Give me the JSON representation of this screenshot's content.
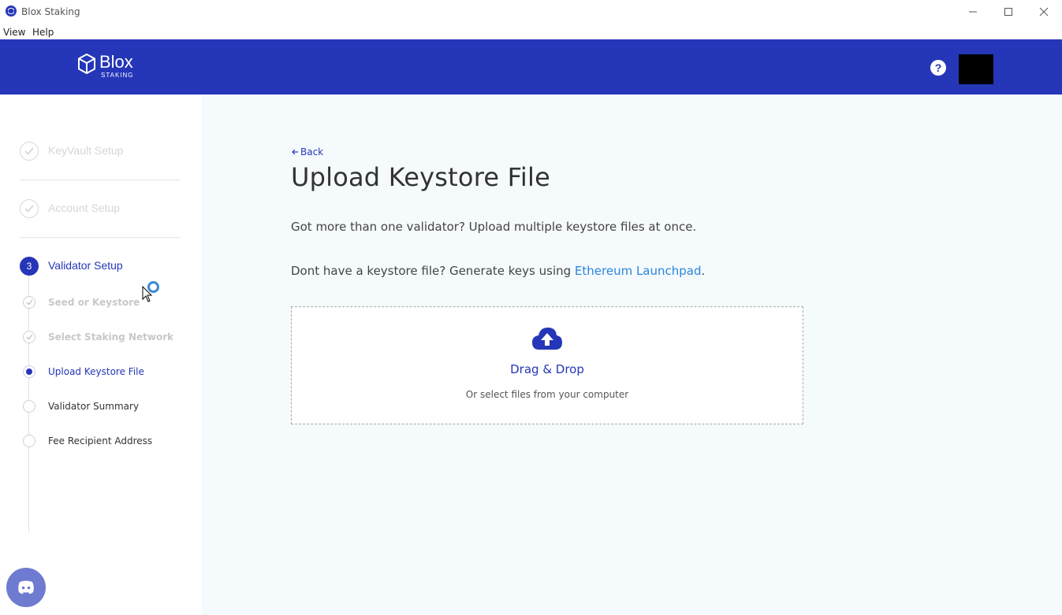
{
  "window": {
    "title": "Blox Staking"
  },
  "menu": {
    "items": [
      "View",
      "Help"
    ]
  },
  "header": {
    "logo_name": "Blox",
    "logo_sub": "STAKING",
    "help_label": "?"
  },
  "sidebar": {
    "steps": [
      {
        "number": "",
        "label": "KeyVault Setup",
        "state": "done"
      },
      {
        "number": "",
        "label": "Account Setup",
        "state": "done"
      },
      {
        "number": "3",
        "label": "Validator Setup",
        "state": "active"
      }
    ],
    "substeps": [
      {
        "label": "Seed or Keystore",
        "state": "done"
      },
      {
        "label": "Select Staking Network",
        "state": "done"
      },
      {
        "label": "Upload Keystore File",
        "state": "current"
      },
      {
        "label": "Validator Summary",
        "state": "todo"
      },
      {
        "label": "Fee Recipient Address",
        "state": "todo"
      }
    ]
  },
  "main": {
    "back_label": "Back",
    "title": "Upload Keystore File",
    "para1": "Got more than one validator? Upload multiple keystore files at once.",
    "para2_prefix": "Dont have a keystore file? Generate keys using ",
    "para2_link": "Ethereum Launchpad",
    "para2_suffix": ".",
    "dropzone": {
      "title": "Drag & Drop",
      "subtitle": "Or select files from your computer"
    }
  },
  "colors": {
    "brand": "#2536b8",
    "link": "#2a86d8",
    "main_bg": "#f5fafd"
  }
}
